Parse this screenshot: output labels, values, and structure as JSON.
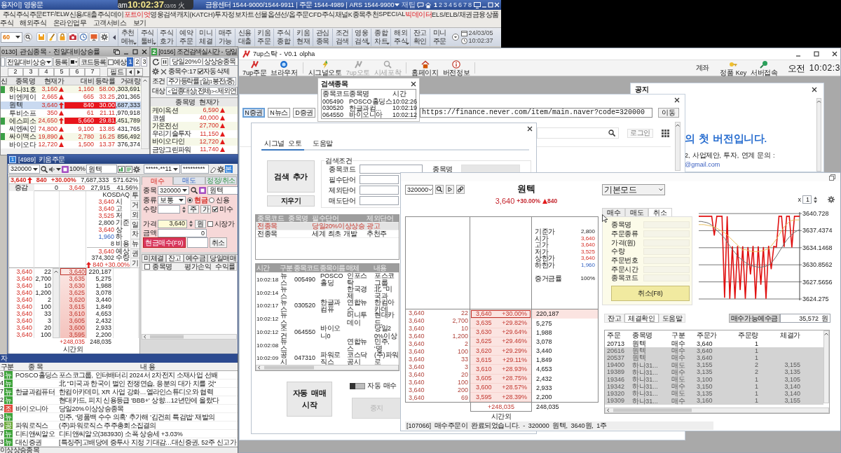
{
  "hts": {
    "title": "용자이] 영웅문",
    "service_info": "금융센터 1544-9000/1544-9911 | 주문 1544-4989 | ARS 1544-9900",
    "tip_label": "재팁",
    "screens": [
      {
        "label": "1",
        "selected": true
      },
      {
        "label": "2",
        "selected": false
      },
      {
        "label": "3",
        "selected": false
      },
      {
        "label": "4",
        "selected": false
      },
      {
        "label": "5",
        "selected": false
      },
      {
        "label": "6",
        "selected": false
      },
      {
        "label": "7",
        "selected": false
      },
      {
        "label": "8",
        "selected": false
      }
    ],
    "menu_row_1": [
      {
        "label": "주식",
        "highlighted": false
      },
      {
        "label": "주식주문",
        "highlighted": false
      },
      {
        "label": "ETF/ELW",
        "highlighted": false
      },
      {
        "label": "신용/대출",
        "highlighted": false
      },
      {
        "label": "주식데이",
        "highlighted": false
      },
      {
        "label": "포트이엇",
        "highlighted": true
      },
      {
        "label": "영웅검색",
        "highlighted": false
      },
      {
        "label": "캐치(KATCH)",
        "highlighted": false
      },
      {
        "label": "투자정보",
        "highlighted": false
      },
      {
        "label": "차트",
        "highlighted": false
      },
      {
        "label": "선물옵션",
        "highlighted": false
      },
      {
        "label": "선/옵주문",
        "highlighted": false
      },
      {
        "label": "CFD주식",
        "highlighted": false
      },
      {
        "label": "채널K",
        "highlighted": false
      },
      {
        "label": "종목추천",
        "highlighted": false
      },
      {
        "label": "SPECIAL",
        "highlighted": false
      },
      {
        "label": "빅데이터",
        "highlighted": true
      },
      {
        "label": "ELS/ELB/채권",
        "highlighted": false
      },
      {
        "label": "금융상품",
        "highlighted": false
      }
    ],
    "menu_row_2": [
      "주식",
      "해외주식",
      "온라인업무",
      "고객서비스",
      "보기"
    ],
    "toolbar": {
      "screen_number": "60",
      "quick_buttons": [
        {
          "lines": [
            "추천",
            "메뉴"
          ],
          "has_menu": true
        },
        {
          "lines": [
            "주식",
            "툴바"
          ],
          "has_menu": true
        },
        {
          "lines": [
            "주식",
            "호가"
          ],
          "has_menu": false
        },
        {
          "lines": [
            "예약",
            "주문"
          ],
          "has_menu": false
        },
        {
          "lines": [
            "미니",
            "체결"
          ],
          "has_menu": false
        },
        {
          "lines": [
            "매주",
            "가능"
          ],
          "has_menu": false
        },
        {
          "lines": [
            "신용",
            "대출"
          ],
          "has_menu": false
        },
        {
          "lines": [
            "키움",
            "주문"
          ],
          "has_menu": false
        },
        {
          "lines": [
            "주식",
            "종합"
          ],
          "has_menu": false
        },
        {
          "lines": [
            "키움",
            "현재"
          ],
          "has_menu": false
        },
        {
          "lines": [
            "관심",
            "종목"
          ],
          "has_menu": false
        },
        {
          "lines": [
            "조건",
            "검색"
          ],
          "has_menu": false
        },
        {
          "lines": [
            "영웅",
            "검색"
          ],
          "has_menu": true
        },
        {
          "lines": [
            "종합",
            "차트"
          ],
          "has_menu": true
        },
        {
          "lines": [
            "해외",
            "주식"
          ],
          "has_menu": true
        },
        {
          "lines": [
            "잔고",
            "확인"
          ],
          "has_menu": false
        },
        {
          "lines": [
            "미니",
            "주문"
          ],
          "has_menu": false
        }
      ],
      "date": "24/03/05",
      "time": "10:02:37"
    }
  },
  "clock": {
    "period": "am",
    "time": "10:02:37",
    "date": "03/05 火"
  },
  "watchlist": {
    "title": "0130] 관심종목 - 전일대비상승률",
    "group": "전일대비상승",
    "register_button": "등록",
    "code_register_button": "코드등록",
    "expected": {
      "label": "예상",
      "checked": false
    },
    "pages": [
      {
        "label": "1",
        "selected": true
      },
      {
        "label": "2",
        "selected": false
      },
      {
        "label": "3",
        "selected": false
      }
    ],
    "group_tabs": [
      "2",
      "3",
      "4",
      "5",
      "6",
      "7"
    ],
    "field_button": "필드",
    "columns": [
      "신",
      "종목명",
      "현재가",
      "대비",
      "등락률",
      "거래량"
    ],
    "rows": [
      {
        "news": true,
        "name": "하나31호",
        "price": "3,160",
        "limit_up": false,
        "change": "1,160",
        "rate": "58.00",
        "volume": ",303,691",
        "selected": false,
        "highlighted": false
      },
      {
        "news": false,
        "name": "비엔케이",
        "price": "2,665",
        "limit_up": false,
        "change": "665",
        "rate": "33.25",
        "volume": ",201,365",
        "selected": false,
        "highlighted": false
      },
      {
        "news": false,
        "name": "원텍",
        "price": "3,640",
        "limit_up": true,
        "change": "840",
        "rate": "30.00",
        "volume": ",687,333",
        "selected": true,
        "highlighted": true
      },
      {
        "news": false,
        "name": "투비소프",
        "price": "350",
        "limit_up": false,
        "change": "61",
        "rate": "21.11",
        "volume": ",970,918",
        "selected": false,
        "highlighted": false
      },
      {
        "news": true,
        "name": "에스피소",
        "price": "24,650",
        "limit_up": true,
        "change": "5,660",
        "rate": "29.81",
        "volume": ",451,789",
        "selected": false,
        "highlighted": true
      },
      {
        "news": false,
        "name": "씨엔씨인",
        "price": "74,800",
        "limit_up": false,
        "change": "9,100",
        "rate": "13.85",
        "volume": "431,765",
        "selected": false,
        "highlighted": false
      },
      {
        "news": true,
        "name": "싸이맥스",
        "price": "19,890",
        "limit_up": false,
        "change": "2,780",
        "rate": "16.25",
        "volume": "856,492",
        "selected": false,
        "highlighted": false
      },
      {
        "news": false,
        "name": "바이오다",
        "price": "12,720",
        "limit_up": false,
        "change": "1,500",
        "rate": "13.37",
        "volume": "376,374",
        "selected": false,
        "highlighted": false
      }
    ]
  },
  "condition_search": {
    "badge": "2",
    "title": "[0156] 조건검색실시간 - 당일",
    "condition": "당일20%이상상승종목",
    "count": "종목수:17",
    "auto_delete": {
      "label": "자동삭제",
      "checked": true
    },
    "condition_label": "조건",
    "condition_value": "주가등락률:[일]1봉전(중)",
    "target_label": "대상",
    "target_value": "<업종대상(전체)><제외연",
    "columns": [
      "종목명",
      "현재가"
    ],
    "rows": [
      {
        "name": "케이옥션",
        "price": "6,590"
      },
      {
        "name": "코셈",
        "price": "40,000"
      },
      {
        "name": "가온전선",
        "price": "27,700"
      },
      {
        "name": "우리기술투자",
        "price": "11,150"
      },
      {
        "name": "바이오다인",
        "price": "12,720"
      },
      {
        "name": "금양그린파워",
        "price": "11,740"
      }
    ]
  },
  "order_window": {
    "badge": "1",
    "title": "[4989] 키움주문",
    "code": "320000",
    "zoom": "100%",
    "stock_name": "원텍",
    "account": "*****-**11",
    "password": "*********",
    "account_type": "본",
    "quote": {
      "price": "3,640",
      "change": "840",
      "rate": "+30.00%",
      "volume": "7,687,333",
      "volume_rate": "571.62%"
    },
    "quote_2": {
      "label": "증감",
      "delta": "0",
      "price": "3,640",
      "volume": "27,915",
      "rate": "41.56%"
    },
    "market": "KOSDAQ",
    "info": [
      {
        "number": "3,640",
        "item": "시",
        "kind": "up"
      },
      {
        "number": "3,640",
        "item": "고",
        "kind": "up"
      },
      {
        "number": "3,525",
        "item": "저",
        "kind": "up"
      },
      {
        "number": "2,800",
        "item": "기준",
        "kind": "flat"
      },
      {
        "number": "3,640",
        "item": "상",
        "kind": "up"
      },
      {
        "number": "1,960",
        "item": "하",
        "kind": "down"
      },
      {
        "number": "8",
        "item": "비용",
        "kind": "flat"
      },
      {
        "number": "3,640",
        "item": "예상",
        "kind": "up"
      },
      {
        "number": "374,302",
        "item": "수량",
        "kind": "flat"
      }
    ],
    "info_change": "840",
    "info_rate": "+30.00%",
    "side_tabs": [
      "투",
      "거",
      "외",
      "일",
      "차",
      "뉴",
      "권",
      "기"
    ],
    "book": [
      {
        "ask": "3,640",
        "qty": "22",
        "price": "3,640",
        "volume": "220,187",
        "current": true
      },
      {
        "ask": "3,640",
        "qty": "2,700",
        "price": "3,635",
        "volume": "5,275",
        "current": false
      },
      {
        "ask": "3,640",
        "qty": "10",
        "price": "3,630",
        "volume": "1,988",
        "current": false
      },
      {
        "ask": "3,640",
        "qty": "1,200",
        "price": "3,625",
        "volume": "3,078",
        "current": false
      },
      {
        "ask": "3,640",
        "qty": "2",
        "price": "3,620",
        "volume": "3,440",
        "current": false
      },
      {
        "ask": "3,640",
        "qty": "100",
        "price": "3,615",
        "volume": "1,849",
        "current": false
      },
      {
        "ask": "3,640",
        "qty": "33",
        "price": "3,610",
        "volume": "4,653",
        "current": false
      },
      {
        "ask": "3,640",
        "qty": "3",
        "price": "3,605",
        "volume": "2,432",
        "current": false
      },
      {
        "ask": "3,640",
        "qty": "20",
        "price": "3,600",
        "volume": "2,933",
        "current": false
      },
      {
        "ask": "3,640",
        "qty": "100",
        "price": "3,595",
        "volume": "2,200",
        "current": false
      }
    ],
    "book_total": "+248,035",
    "book_total_volume": "248,035",
    "session": "시간외",
    "form": {
      "tabs": [
        {
          "label": "매수",
          "selected": true
        },
        {
          "label": "매도",
          "selected": false
        },
        {
          "label": "정정/취소",
          "selected": false
        }
      ],
      "code_label": "종목",
      "code": "320000",
      "name": "원텍",
      "type_label": "종류",
      "type": "보통",
      "settlement": [
        {
          "label": "현금",
          "selected": true
        },
        {
          "label": "신용",
          "selected": false
        }
      ],
      "qty_label": "수량",
      "unit_button": "주",
      "price_button": "가",
      "margin": {
        "label": "미수",
        "checked": true
      },
      "price_label": "가격",
      "price": "3,640",
      "currency_button": "원",
      "market_price": {
        "label": "시장가",
        "checked": false
      },
      "amount_label": "금액",
      "amount": "0",
      "submit_button": "현금매수(F9)",
      "cancel_button": "취소"
    },
    "lower_tabs": [
      {
        "label": "미체결",
        "selected": false
      },
      {
        "label": "잔고",
        "selected": true
      },
      {
        "label": "예수금",
        "selected": false
      },
      {
        "label": "당일매매",
        "selected": false
      }
    ],
    "select_all_checked": false,
    "lower_columns": [
      "종목명",
      "평가손익",
      "수익률"
    ]
  },
  "news_window": {
    "title": "자",
    "columns": [
      "구분",
      "종 목",
      "내 용"
    ],
    "rows": [
      {
        "column_1": "3",
        "badge": "뉴",
        "color": "#3ea33a",
        "stock": "POSCO홀딩스",
        "headline": "포스코그룹, 인터배터리 2024서 2차전지 소재사업 선봬"
      },
      {
        "column_1": "4",
        "badge": "뉴",
        "color": "#3ea33a",
        "headline": "北 \"미국과 한국이 벌인 전쟁연습, 응분의 대가 치를 것\""
      },
      {
        "column_1": "7",
        "badge": "뉴",
        "color": "#3ea33a",
        "stock": "한글과컴퓨터",
        "headline": "한컴아카데미, XR 사업 강화…엘라인스튜디오와 협력"
      },
      {
        "column_1": "2",
        "badge": "뉴",
        "color": "#3ea33a",
        "headline": "현대카드, 피치 신용등급 'BBB+' 상향…12년만에 올랐다"
      },
      {
        "column_1": "2",
        "badge": "조",
        "color": "#e0463a",
        "stock": "바이오니아",
        "headline": "당일20%이상상승종목"
      },
      {
        "column_1": "3",
        "badge": "뉴",
        "color": "#3ea33a",
        "headline": "민주, '명품백 수수 의혹' 추가해 '김건희 특검법' 재발의"
      },
      {
        "column_1": "9",
        "badge": "공",
        "color": "#6aa83a",
        "stock": "파워로직스",
        "headline": "(주)파워로직스 주주총회소집결의"
      },
      {
        "column_1": "7",
        "badge": "뉴",
        "color": "#3ea33a",
        "stock": "디티앤씨알오",
        "headline": "디티앤씨알오(383930) 소폭 상승세 +3.03%"
      },
      {
        "column_1": "3",
        "badge": "뉴",
        "color": "#3ea33a",
        "stock": "대신증권",
        "headline": "[특징주]고배당에 증투사 지정 기대감…대신증권, 52주 신고가"
      }
    ],
    "status": "이상상승종목"
  },
  "sevenup": {
    "title": "7up스탁 - V0.1 olpha",
    "toolbar": [
      {
        "label": "7up주문",
        "disabled": false
      },
      {
        "label": "브라우저",
        "disabled": false
      },
      {
        "label": "시그널오토",
        "disabled": false
      },
      {
        "label": "7up오토",
        "disabled": true
      },
      {
        "label": "시세포착",
        "disabled": true
      },
      {
        "label": "홈페이지",
        "disabled": false
      },
      {
        "label": "버전정보",
        "disabled": false
      }
    ],
    "account_button": "계좌",
    "key_button": "정품 Key",
    "server_button": "서버접속",
    "period": "오전",
    "time": "10:02:3",
    "site_buttons": [
      {
        "label": "N증권",
        "selected": true
      },
      {
        "label": "N뉴스",
        "selected": false
      },
      {
        "label": "D증권",
        "selected": false
      }
    ],
    "url": "https://finance.never.com/item/main.naver?code=320000",
    "go_button": "이동",
    "login_button": "로그인",
    "notice": {
      "title": "공지",
      "headline": "의 첫 버전입니다.",
      "contact": "2, 사업제안, 투자, 연계 문의 :",
      "email": "@gmail.com"
    },
    "search_results": {
      "title": "검색종목",
      "columns": [
        "종목코드",
        "종목명",
        "시간"
      ],
      "rows": [
        {
          "code": "005490",
          "name": "POSCO홀딩스",
          "time": "10:02:26"
        },
        {
          "code": "030520",
          "name": "한글과컴...",
          "time": "10:02:19"
        },
        {
          "code": "064550",
          "name": "바이오니아",
          "time": "10:02:12"
        }
      ]
    },
    "signal": {
      "tabs": [
        {
          "label": "시그널 오토",
          "selected": true
        },
        {
          "label": "도움말",
          "selected": false
        }
      ],
      "add_button": "검색 추가",
      "clear_button": "지우기",
      "criteria_title": "검색조건",
      "criteria_fields": [
        "종목코드",
        "필수단어",
        "제외단어",
        "매도단어"
      ],
      "name_label": "종목명",
      "rule_columns": [
        "종목코드",
        "종목명",
        "필수단어",
        "제외단어"
      ],
      "rules": [
        {
          "code": "전종목",
          "required": "당일20%이상상승",
          "excluded": "광고",
          "selected": true
        },
        {
          "code": "전종목",
          "required": "세계 최초 개발",
          "excluded": "추천주",
          "selected": false
        }
      ],
      "news_columns": [
        "시간",
        "구분",
        "종목코드",
        "종목이름",
        "매체",
        "내용"
      ],
      "news": [
        {
          "time": "10:02:18",
          "type": "뉴스",
          "code": "005490",
          "name": "POSCO홀딩",
          "source": "인포스탁",
          "content": "포스코그룹"
        },
        {
          "time": "10:02:14",
          "type": "뉴스",
          "source": "한국경제",
          "content": "北 \"미국과"
        },
        {
          "time": "10:02:17",
          "type": "뉴스",
          "code": "030520",
          "name": "한글과컴퓨",
          "source": "연합뉴스",
          "content": "한컴아카데"
        },
        {
          "time": "10:02:12",
          "type": "뉴스",
          "source": "머니투데이",
          "content": "현대카드,"
        },
        {
          "time": "10:02:12",
          "type": "조건",
          "code": "064550",
          "name": "바이오니0",
          "content": "당일20%이상"
        },
        {
          "time": "10:02:08",
          "type": "뉴스",
          "source": "연합뉴스",
          "content": "민주, '명"
        },
        {
          "time": "10:02:09",
          "type": "공시",
          "code": "047310",
          "name": "파워로직스",
          "source": "코스닥공시",
          "content": "(주)파워로"
        }
      ],
      "start_button": [
        "자동 매매",
        "시작"
      ],
      "auto_buy": {
        "label": "자동 매수",
        "on": false
      },
      "stop_button": {
        "label": "중지",
        "disabled": true
      }
    },
    "stock": {
      "code": "320000",
      "name": "원텍",
      "price": "3,640",
      "rate": "+30.00%",
      "change": "840",
      "mode": "기본모드",
      "multiplier_label": "x",
      "multiplier": "1",
      "info": [
        {
          "label": "기준가",
          "value": "2,800",
          "kind": "flat"
        },
        {
          "label": "시가",
          "value": "3,640",
          "kind": "up"
        },
        {
          "label": "고가",
          "value": "3,640",
          "kind": "up"
        },
        {
          "label": "저가",
          "value": "3,525",
          "kind": "up"
        },
        {
          "label": "상한가",
          "value": "3,640",
          "kind": "up"
        },
        {
          "label": "하한가",
          "value": "1,960",
          "kind": "down"
        }
      ],
      "margin_rate": {
        "label": "증거금률",
        "value": "100%"
      },
      "asks": [
        {
          "price": "3,640",
          "qty": "22"
        },
        {
          "price": "3,640",
          "qty": "2,700"
        },
        {
          "price": "3,640",
          "qty": "10"
        },
        {
          "price": "3,640",
          "qty": "1,200"
        },
        {
          "price": "3,640",
          "qty": "2"
        },
        {
          "price": "3,640",
          "qty": "100"
        },
        {
          "price": "3,640",
          "qty": "33"
        },
        {
          "price": "3,640",
          "qty": "3"
        },
        {
          "price": "3,640",
          "qty": "20"
        },
        {
          "price": "3,640",
          "qty": "100"
        },
        {
          "price": "3,640",
          "qty": "200"
        },
        {
          "price": "3,640",
          "qty": "69"
        }
      ],
      "quotes": [
        {
          "price": "3,640",
          "rate": "+30.00%",
          "volume": "220,187",
          "current": true
        },
        {
          "price": "3,635",
          "rate": "+29.82%",
          "volume": "5,275",
          "current": false
        },
        {
          "price": "3,630",
          "rate": "+29.64%",
          "volume": "1,988",
          "current": false
        },
        {
          "price": "3,625",
          "rate": "+29.46%",
          "volume": "3,078",
          "current": false
        },
        {
          "price": "3,620",
          "rate": "+29.29%",
          "volume": "3,440",
          "current": false
        },
        {
          "price": "3,615",
          "rate": "+29.11%",
          "volume": "1,849",
          "current": false
        },
        {
          "price": "3,610",
          "rate": "+28.93%",
          "volume": "4,653",
          "current": false
        },
        {
          "price": "3,605",
          "rate": "+28.75%",
          "volume": "2,432",
          "current": false
        },
        {
          "price": "3,600",
          "rate": "+28.57%",
          "volume": "2,933",
          "current": false
        },
        {
          "price": "3,595",
          "rate": "+28.39%",
          "volume": "2,200",
          "current": false
        }
      ],
      "total": "+248,035",
      "total_volume": "248,035",
      "session": "시간외",
      "order_tabs": [
        {
          "label": "매수",
          "selected": false
        },
        {
          "label": "매도",
          "selected": false
        },
        {
          "label": "취소",
          "selected": true
        }
      ],
      "order_fields": [
        "종목명",
        "주문종류",
        "가격(원)",
        "수량",
        "주문번호",
        "주문시간",
        "종목코드"
      ],
      "cancel_button": "취소(F8)",
      "chart_data": {
        "type": "line",
        "grid": true,
        "ylim": [
          3624.275,
          3640.728
        ],
        "yticks": [
          3624.275,
          3627.5656,
          3630.8562,
          3634.1468,
          3637.4374,
          3640.728
        ],
        "series": [
          {
            "color": "#e01010",
            "values": [
              3640.2,
              3640.2,
              3640.2,
              3640.2,
              3640.2,
              3640.2,
              3636.5,
              3640.2,
              3640.2,
              3640.2,
              3624.5,
              3640.2,
              3624.3,
              3634.4,
              3624.3,
              3634.5,
              3626,
              3634.4,
              3624.3,
              3634.3,
              3629,
              3634.5,
              3624.3,
              3634.4,
              3627,
              3634.3,
              3624.3,
              3634.5,
              3630,
              3634.4,
              3634.3,
              3640.2,
              3640.2,
              3634.3,
              3640.2,
              3640.2,
              3634.2,
              3640.2,
              3640.2,
              3640.2
            ]
          },
          {
            "color": "#707070",
            "values": [
              3639.2,
              3639.2,
              3639.1,
              3639,
              3638.8,
              3638.5,
              3638,
              3637.5,
              3637,
              3636.5,
              3636,
              3635.2,
              3634.5,
              3633.8,
              3633.2,
              3632.6,
              3632.1,
              3631.7,
              3631.3,
              3631,
              3630.8,
              3630.6,
              3630.5,
              3630.4,
              3630.4,
              3630.5,
              3630.6,
              3630.8,
              3631.2,
              3631.8,
              3632.5,
              3633.3,
              3634.1,
              3634.9,
              3635.6,
              3636.2,
              3636.7,
              3637.1,
              3637.4,
              3637.6
            ]
          },
          {
            "color": "#e8c060",
            "values": [
              3638.6,
              3638.6,
              3638.6,
              3638.5,
              3638.4,
              3638.3,
              3638.1,
              3637.9,
              3637.6,
              3637.3,
              3637,
              3636.6,
              3636.1,
              3635.6,
              3635.1,
              3634.7,
              3634.1,
              3633.7,
              3633.8,
              3633.6,
              3633.5,
              3633.4,
              3633.4,
              3633.4,
              3633.5,
              3633.6,
              3633.8,
              3633.9,
              3634.5,
              3635.1,
              3635.8,
              3636.6,
              3637.4,
              3638.1,
              3638.7,
              3639.1,
              3639.4,
              3639.5,
              3639.5,
              3639.5
            ]
          }
        ]
      },
      "bottom_tabs": [
        {
          "label": "잔고",
          "selected": false
        },
        {
          "label": "체결확인",
          "selected": true
        },
        {
          "label": "도움말",
          "selected": false
        }
      ],
      "deposit_label": "매수가능예수금",
      "deposit": "35,572 원",
      "fill_columns": [
        "주문",
        "종목명",
        "구분",
        "주문가",
        "주문량",
        "체결가"
      ],
      "fills": [
        {
          "order": "20713",
          "name": "원텍",
          "side": "매수",
          "price": "3,640",
          "qty": "1",
          "struck": false
        },
        {
          "order": "20616",
          "name": "원텍",
          "side": "매수",
          "price": "3,640",
          "qty": "1",
          "struck": true
        },
        {
          "order": "20537",
          "name": "원텍",
          "side": "매수",
          "price": "3,640",
          "qty": "1",
          "struck": true
        },
        {
          "order": "19400",
          "name": "하나31...",
          "side": "매도",
          "price": "3,155",
          "qty": "2",
          "fill_price": "3,155",
          "struck": true
        },
        {
          "order": "19389",
          "name": "하나31...",
          "side": "매수",
          "price": "3,135",
          "qty": "2",
          "fill_price": "3,135",
          "struck": true
        },
        {
          "order": "19346",
          "name": "하나31...",
          "side": "매도",
          "price": "3,100",
          "qty": "1",
          "fill_price": "3,105",
          "struck": true
        },
        {
          "order": "19342",
          "name": "하나31...",
          "side": "매수",
          "price": "3,150",
          "qty": "1",
          "fill_price": "3,140",
          "struck": true
        },
        {
          "order": "19320",
          "name": "하나31...",
          "side": "매도",
          "price": "3,135",
          "qty": "1",
          "fill_price": "3,140",
          "struck": true
        },
        {
          "order": "19309",
          "name": "하나31...",
          "side": "매수",
          "price": "3,160",
          "qty": "1",
          "fill_price": "3,155",
          "struck": true
        }
      ],
      "status": "[107066] 매수주문이 완료되었습니다. - 320000 원텍, 3640원, 1주"
    }
  }
}
